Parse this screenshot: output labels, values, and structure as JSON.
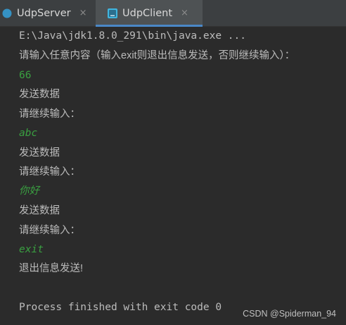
{
  "tabs": [
    {
      "label": "UdpServer",
      "icon": "java-class-icon",
      "active": false
    },
    {
      "label": "UdpClient",
      "icon": "java-class-icon",
      "active": true
    }
  ],
  "close_glyph": "×",
  "console": {
    "lines": [
      {
        "text": "E:\\Java\\jdk1.8.0_291\\bin\\java.exe ...",
        "kind": "command"
      },
      {
        "text": "请输入任意内容（输入exit则退出信息发送，否则继续输入）：",
        "kind": "stdout"
      },
      {
        "text": "66",
        "kind": "stdin"
      },
      {
        "text": "发送数据",
        "kind": "stdout"
      },
      {
        "text": "请继续输入：",
        "kind": "stdout"
      },
      {
        "text": "abc",
        "kind": "stdin"
      },
      {
        "text": "发送数据",
        "kind": "stdout"
      },
      {
        "text": "请继续输入：",
        "kind": "stdout"
      },
      {
        "text": "你好",
        "kind": "stdin"
      },
      {
        "text": "发送数据",
        "kind": "stdout"
      },
      {
        "text": "请继续输入：",
        "kind": "stdout"
      },
      {
        "text": "exit",
        "kind": "stdin"
      },
      {
        "text": "退出信息发送!",
        "kind": "stdout"
      },
      {
        "text": "",
        "kind": "blank"
      },
      {
        "text": "Process finished with exit code 0",
        "kind": "exit"
      }
    ]
  },
  "watermark": "CSDN @Spiderman_94",
  "colors": {
    "background": "#2b2b2b",
    "tabbar": "#3c3f41",
    "active_tab_underline": "#4a88c7",
    "stdout": "#bcbcbc",
    "stdin": "#3aa041"
  }
}
